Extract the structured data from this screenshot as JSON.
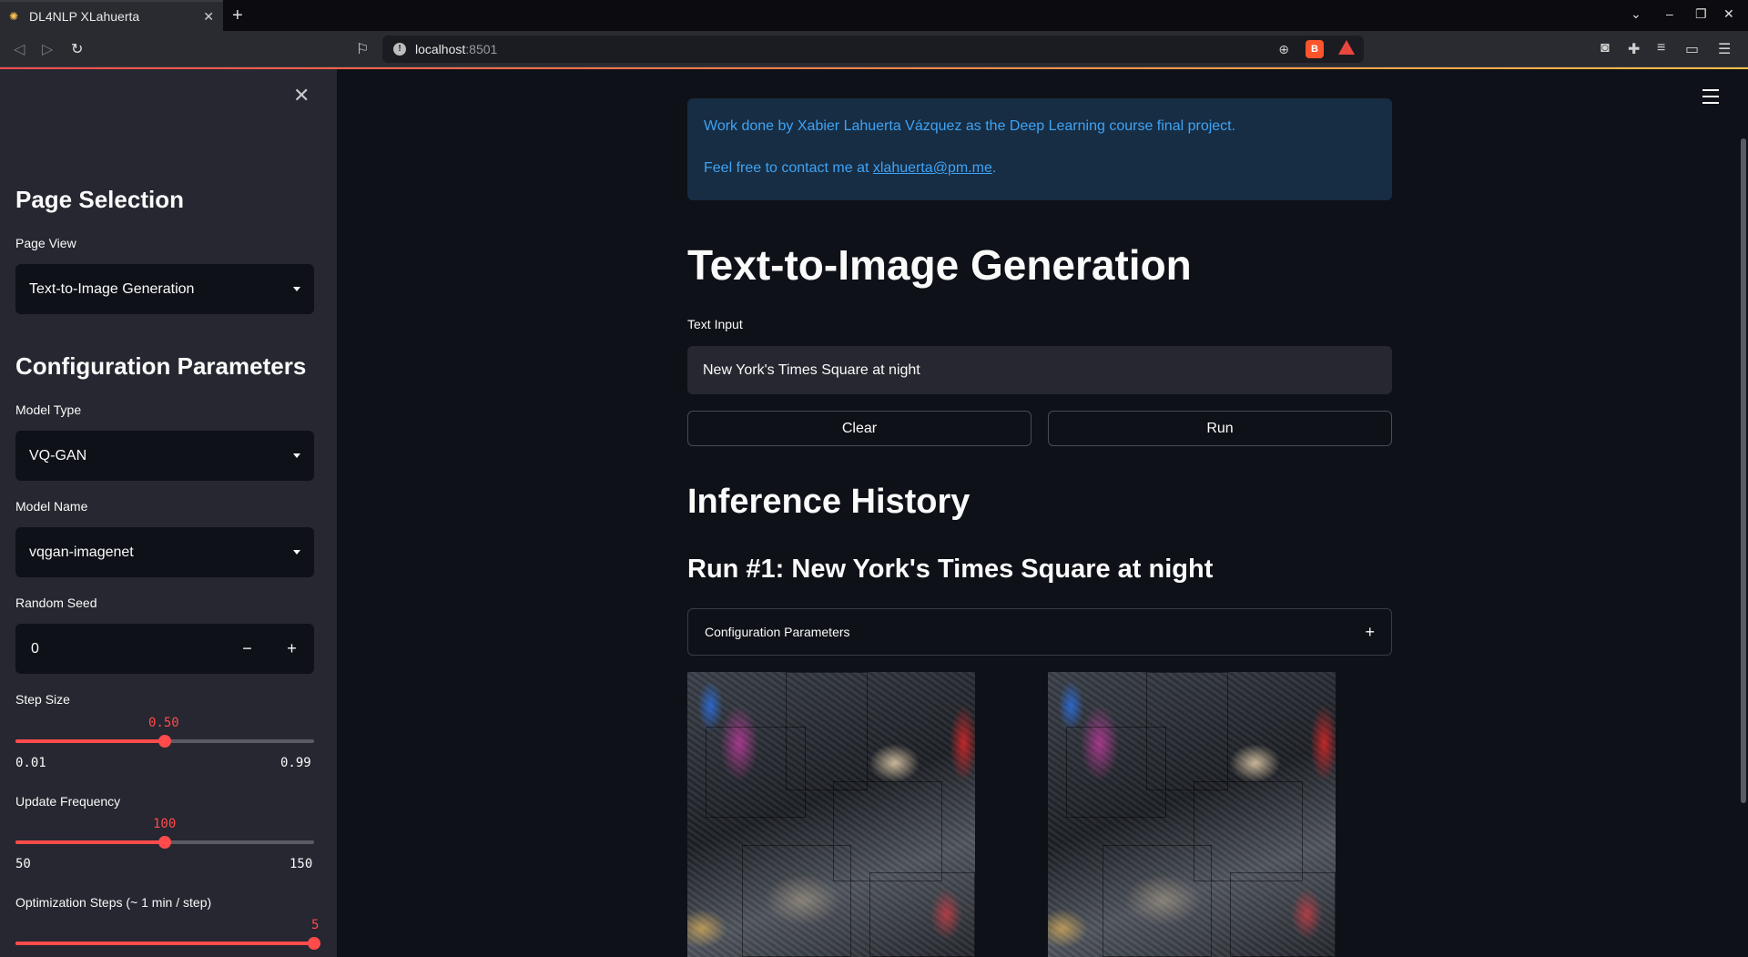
{
  "browser": {
    "tab_title": "DL4NLP XLahuerta",
    "url_host": "localhost",
    "url_port": ":8501",
    "brave_badge": "1"
  },
  "sidebar": {
    "page_selection_heading": "Page Selection",
    "page_view_label": "Page View",
    "page_view_value": "Text-to-Image Generation",
    "config_heading": "Configuration Parameters",
    "model_type_label": "Model Type",
    "model_type_value": "VQ-GAN",
    "model_name_label": "Model Name",
    "model_name_value": "vqgan-imagenet",
    "seed_label": "Random Seed",
    "seed_value": "0",
    "seed_minus": "−",
    "seed_plus": "+",
    "step_size": {
      "label": "Step Size",
      "value": "0.50",
      "min": "0.01",
      "max": "0.99",
      "fraction": 0.5
    },
    "update_freq": {
      "label": "Update Frequency",
      "value": "100",
      "min": "50",
      "max": "150",
      "fraction": 0.5
    },
    "opt_steps": {
      "label": "Optimization Steps (~ 1 min / step)",
      "value": "5",
      "fraction": 1.0
    }
  },
  "main": {
    "info_line1": "Work done by Xabier Lahuerta Vázquez as the Deep Learning course final project.",
    "info_line2_prefix": "Feel free to contact me at ",
    "info_email": "xlahuerta@pm.me",
    "info_line2_suffix": ".",
    "title": "Text-to-Image Generation",
    "text_input_label": "Text Input",
    "text_input_value": "New York's Times Square at night",
    "clear_label": "Clear",
    "run_label": "Run",
    "history_heading": "Inference History",
    "run_heading": "Run #1: New York's Times Square at night",
    "expander_label": "Configuration Parameters",
    "expander_icon": "+"
  },
  "colors": {
    "accent": "#ff4b4b",
    "info_bg": "#172d43",
    "info_text": "#3fa3f5",
    "sidebar_bg": "#262730",
    "main_bg": "#0e1117"
  },
  "icons": [
    "favicon-icon",
    "close-tab-icon",
    "new-tab-icon",
    "back-icon",
    "forward-icon",
    "reload-icon",
    "bookmark-icon",
    "site-info-icon",
    "zoom-icon",
    "brave-shields-icon",
    "brave-rewards-icon",
    "wallet-icon",
    "extensions-icon",
    "media-icon",
    "hamburger-menu-icon",
    "close-sidebar-icon",
    "dropdown-caret-icon",
    "plus-icon"
  ]
}
